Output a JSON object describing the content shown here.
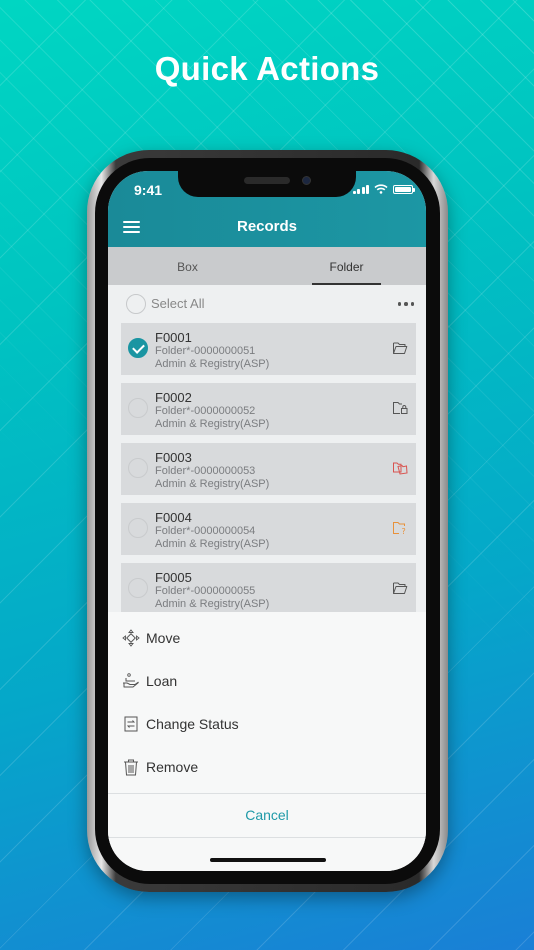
{
  "headline": "Quick Actions",
  "status_bar": {
    "time": "9:41"
  },
  "app_bar": {
    "title": "Records",
    "menu_icon": "hamburger-menu-icon"
  },
  "tabs": [
    {
      "label": "Box",
      "active": false
    },
    {
      "label": "Folder",
      "active": true
    }
  ],
  "select_all": {
    "label": "Select All",
    "more_icon": "ellipsis-icon"
  },
  "records": [
    {
      "id": "F0001",
      "code": "Folder*-0000000051",
      "dept": "Admin & Registry(ASP)",
      "checked": true,
      "icon": "folder-open-icon",
      "icon_color": "#555555"
    },
    {
      "id": "F0002",
      "code": "Folder*-0000000052",
      "dept": "Admin & Registry(ASP)",
      "checked": false,
      "icon": "folder-lock-icon",
      "icon_color": "#555555"
    },
    {
      "id": "F0003",
      "code": "Folder*-0000000053",
      "dept": "Admin & Registry(ASP)",
      "checked": false,
      "icon": "folder-multiple-icon",
      "icon_color": "#d9534f"
    },
    {
      "id": "F0004",
      "code": "Folder*-0000000054",
      "dept": "Admin & Registry(ASP)",
      "checked": false,
      "icon": "folder-question-icon",
      "icon_color": "#e8913a"
    },
    {
      "id": "F0005",
      "code": "Folder*-0000000055",
      "dept": "Admin & Registry(ASP)",
      "checked": false,
      "icon": "folder-open-icon",
      "icon_color": "#555555"
    }
  ],
  "actions": [
    {
      "label": "Move",
      "icon": "move-arrows-icon"
    },
    {
      "label": "Loan",
      "icon": "loan-hand-icon"
    },
    {
      "label": "Change Status",
      "icon": "change-status-icon"
    },
    {
      "label": "Remove",
      "icon": "trash-icon"
    }
  ],
  "cancel_label": "Cancel",
  "colors": {
    "accent": "#1a95a2",
    "app_bar": "#1a8a98",
    "cancel_text": "#1f9aa8"
  }
}
